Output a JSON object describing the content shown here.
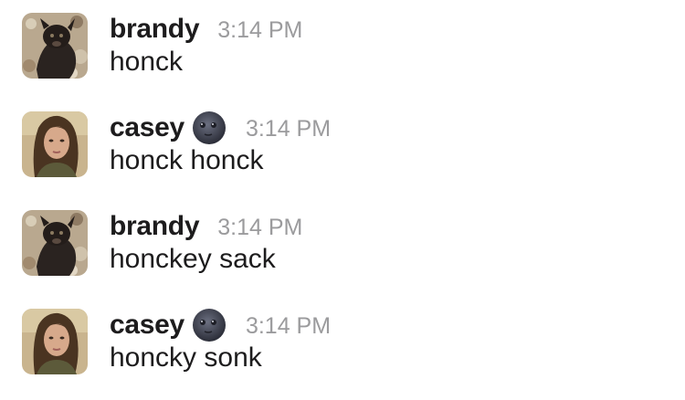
{
  "messages": [
    {
      "author": "brandy",
      "time": "3:14 PM",
      "text": "honck",
      "avatar": "dog-avatar",
      "status_emoji": null
    },
    {
      "author": "casey",
      "time": "3:14 PM",
      "text": "honck honck",
      "avatar": "woman-avatar",
      "status_emoji": "new-moon-face-icon"
    },
    {
      "author": "brandy",
      "time": "3:14 PM",
      "text": "honckey sack",
      "avatar": "dog-avatar",
      "status_emoji": null
    },
    {
      "author": "casey",
      "time": "3:14 PM",
      "text": "honcky sonk",
      "avatar": "woman-avatar",
      "status_emoji": "new-moon-face-icon"
    }
  ],
  "colors": {
    "author": "#1d1c1d",
    "timestamp": "#9b9b9d",
    "message_text": "#1d1c1d"
  }
}
